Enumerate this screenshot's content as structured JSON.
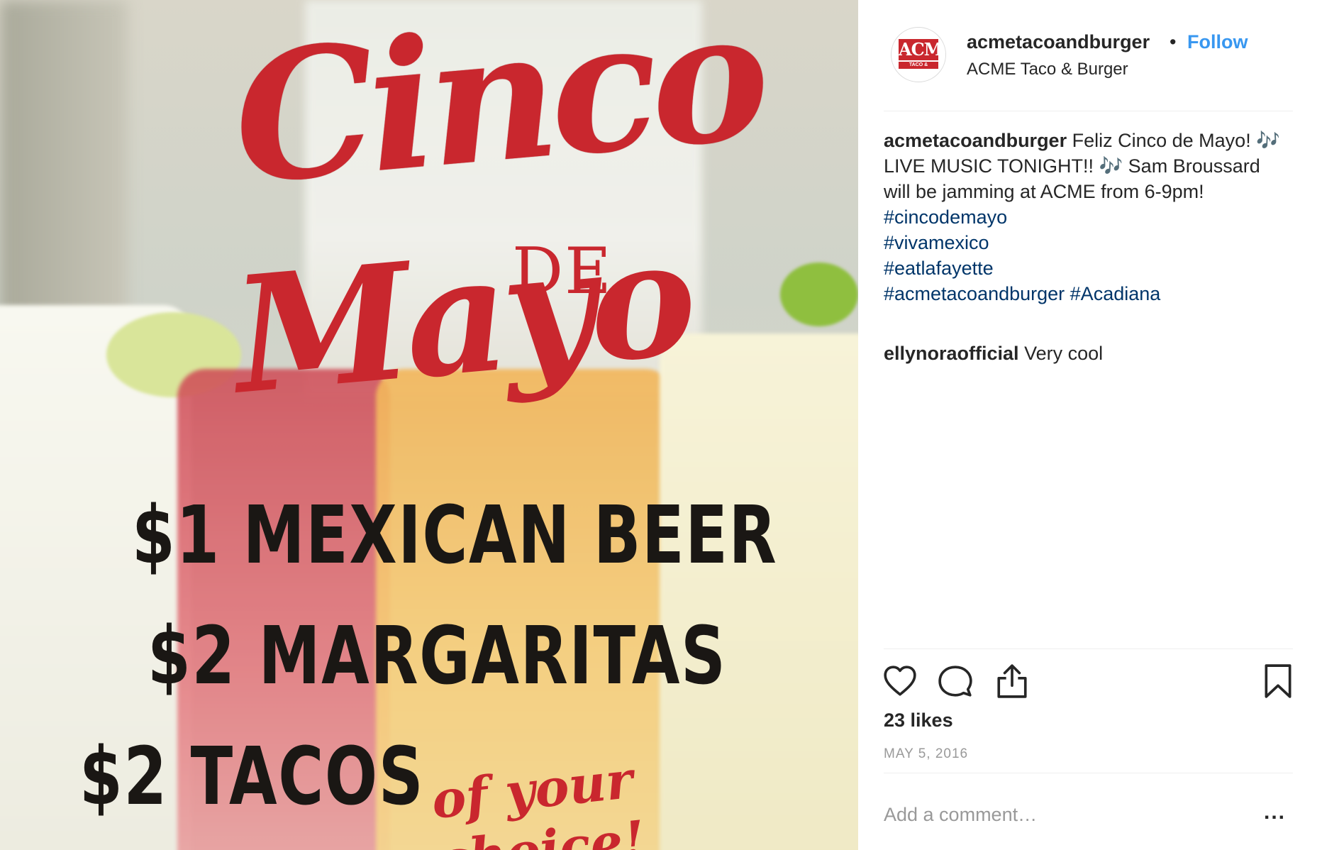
{
  "post_image": {
    "title_line1": "Cinco",
    "title_de": "DE",
    "title_line2": "Mayo",
    "deals": [
      "$1 MEXICAN BEER",
      "$2  MARGARITAS",
      "$2 TACOS"
    ],
    "deal_suffix": "of your choice!",
    "title_color": "#c9272e"
  },
  "header": {
    "avatar_logo_main": "ACME",
    "avatar_logo_sub": "TACO & BURGER",
    "username": "acmetacoandburger",
    "separator": "•",
    "follow_label": "Follow",
    "location": "ACME Taco & Burger",
    "follow_color": "#3897f0"
  },
  "caption": {
    "username": "acmetacoandburger",
    "text": " Feliz Cinco de Mayo! 🎶  LIVE MUSIC TONIGHT!! 🎶  Sam Broussard will be jamming at ACME from 6-9pm!",
    "hashtags": [
      "#cincodemayo",
      "#vivamexico",
      "#eatlafayette",
      "#acmetacoandburger #Acadiana"
    ],
    "hashtag_color": "#003569"
  },
  "comment": {
    "username": "ellynoraofficial",
    "text": " Very cool"
  },
  "actions": {
    "icons": [
      "heart-icon",
      "comment-bubble-icon",
      "share-icon",
      "bookmark-icon"
    ]
  },
  "likes": "23 likes",
  "date": "MAY 5, 2016",
  "comment_box": {
    "placeholder": "Add a comment…",
    "more": "..."
  }
}
